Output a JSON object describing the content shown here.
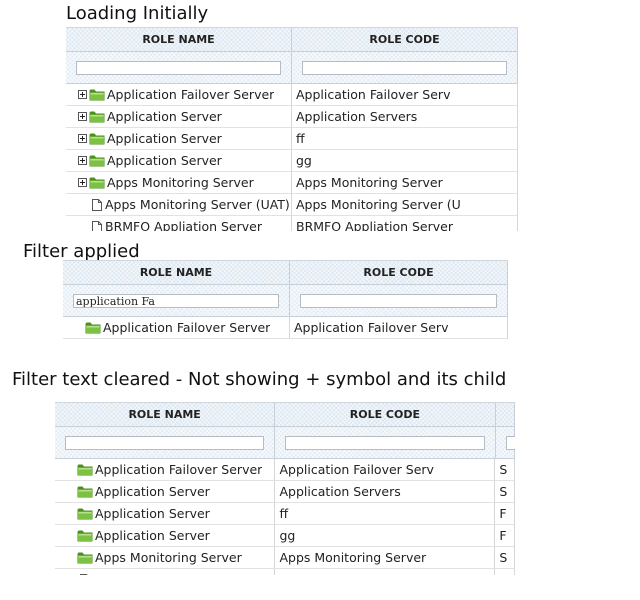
{
  "captions": {
    "loading": "Loading Initially",
    "filter_applied": "Filter applied",
    "filter_cleared": "Filter text cleared - Not showing + symbol and its child"
  },
  "columns": {
    "role_name": "ROLE NAME",
    "role_code": "ROLE CODE"
  },
  "grid_loading": {
    "filter": {
      "role_name": "",
      "role_code": ""
    },
    "rows": [
      {
        "name": "Application Failover Server",
        "code": "Application Failover Serv",
        "icon": "folder-icon",
        "expandable": true
      },
      {
        "name": "Application Server",
        "code": "Application Servers",
        "icon": "folder-icon",
        "expandable": true
      },
      {
        "name": "Application Server",
        "code": "ff",
        "icon": "folder-icon",
        "expandable": true
      },
      {
        "name": "Application Server",
        "code": "gg",
        "icon": "folder-icon",
        "expandable": true
      },
      {
        "name": "Apps Monitoring Server",
        "code": "Apps Monitoring Server",
        "icon": "folder-icon",
        "expandable": true
      },
      {
        "name": "Apps Monitoring Server (UAT)",
        "code": "Apps Monitoring Server (U",
        "icon": "file-icon",
        "expandable": false
      },
      {
        "name": "BRMFO Appliation Server",
        "code": "BRMFO Appliation Server",
        "icon": "file-icon",
        "expandable": false
      }
    ]
  },
  "grid_filtered": {
    "filter": {
      "role_name": "application Fa",
      "role_code": ""
    },
    "rows": [
      {
        "name": "Application Failover Server",
        "code": "Application Failover Serv",
        "icon": "folder-icon",
        "expandable": false
      }
    ]
  },
  "grid_cleared": {
    "filter": {
      "role_name": "",
      "role_code": ""
    },
    "rows": [
      {
        "name": "Application Failover Server",
        "code": "Application Failover Serv",
        "third": "S",
        "icon": "folder-icon",
        "expandable": false
      },
      {
        "name": "Application Server",
        "code": "Application Servers",
        "third": "S",
        "icon": "folder-icon",
        "expandable": false
      },
      {
        "name": "Application Server",
        "code": "ff",
        "third": "F",
        "icon": "folder-icon",
        "expandable": false
      },
      {
        "name": "Application Server",
        "code": "gg",
        "third": "F",
        "icon": "folder-icon",
        "expandable": false
      },
      {
        "name": "Apps Monitoring Server",
        "code": "Apps Monitoring Server",
        "third": "S",
        "icon": "folder-icon",
        "expandable": false
      },
      {
        "name": "",
        "code": "",
        "third": "",
        "icon": "file-icon",
        "expandable": false
      }
    ]
  },
  "colors": {
    "folder": "#7cc242",
    "folder_dark": "#4f8f22",
    "header_bg": "#dde8f1"
  }
}
